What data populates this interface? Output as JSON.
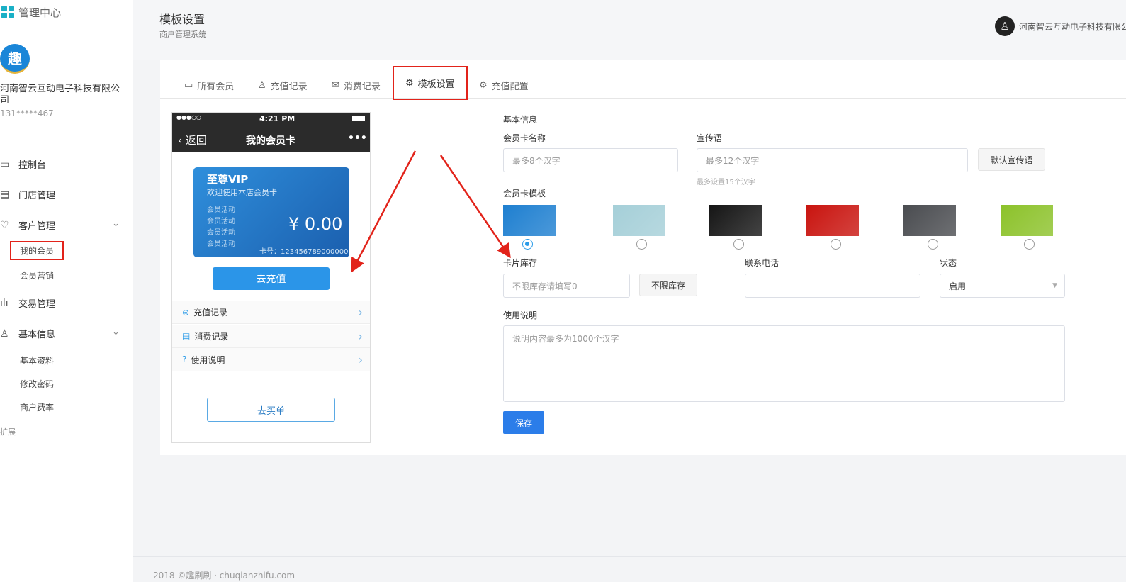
{
  "sidebar": {
    "app_title": "管理中心",
    "company": "河南智云互动电子科技有限公司",
    "phone": "131*****467",
    "nav": [
      {
        "label": "控制台",
        "icon": "monitor-icon"
      },
      {
        "label": "门店管理",
        "icon": "store-icon"
      },
      {
        "label": "客户管理",
        "icon": "heart-icon"
      },
      {
        "label": "交易管理",
        "icon": "bar-chart-icon"
      },
      {
        "label": "基本信息",
        "icon": "user-icon"
      }
    ],
    "customer_sub": [
      "我的会员",
      "会员营销"
    ],
    "info_sub": [
      "基本资料",
      "修改密码",
      "商户费率"
    ],
    "extend": "扩展"
  },
  "header": {
    "title": "模板设置",
    "subtitle": "商户管理系统",
    "user": "河南智云互动电子科技有限公司"
  },
  "tabs": [
    "所有会员",
    "充值记录",
    "消费记录",
    "模板设置",
    "充值配置"
  ],
  "phone": {
    "carrier": "●●●○○",
    "time": "4:21 PM",
    "back": "返回",
    "title": "我的会员卡",
    "more": "•••",
    "card": {
      "name": "至尊VIP",
      "slogan": "欢迎使用本店会员卡",
      "activities": [
        "会员活动",
        "会员活动",
        "会员活动",
        "会员活动"
      ],
      "balance": "¥ 0.00",
      "card_no": "卡号：123456789000000"
    },
    "recharge": "去充值",
    "rows": [
      "充值记录",
      "消费记录",
      "使用说明"
    ],
    "pay": "去买单"
  },
  "form": {
    "section": "基本信息",
    "name_label": "会员卡名称",
    "name_ph": "最多8个汉字",
    "slogan_label": "宣传语",
    "slogan_ph": "最多12个汉字",
    "slogan_hint": "最多设置15个汉字",
    "default_slogan": "默认宣传语",
    "template_label": "会员卡模板",
    "templates": [
      "#1e7fd0",
      "#a5cfd8",
      "#151515",
      "#c9140f",
      "#4a4c50",
      "#8cc22a"
    ],
    "stock_label": "卡片库存",
    "stock_ph": "不限库存请填写0",
    "unlimited": "不限库存",
    "phone_label": "联系电话",
    "status_label": "状态",
    "status_value": "启用",
    "desc_label": "使用说明",
    "desc_ph": "说明内容最多为1000个汉字",
    "save": "保存"
  },
  "footer": "2018 ©趣刷刷 · chuqianzhifu.com"
}
